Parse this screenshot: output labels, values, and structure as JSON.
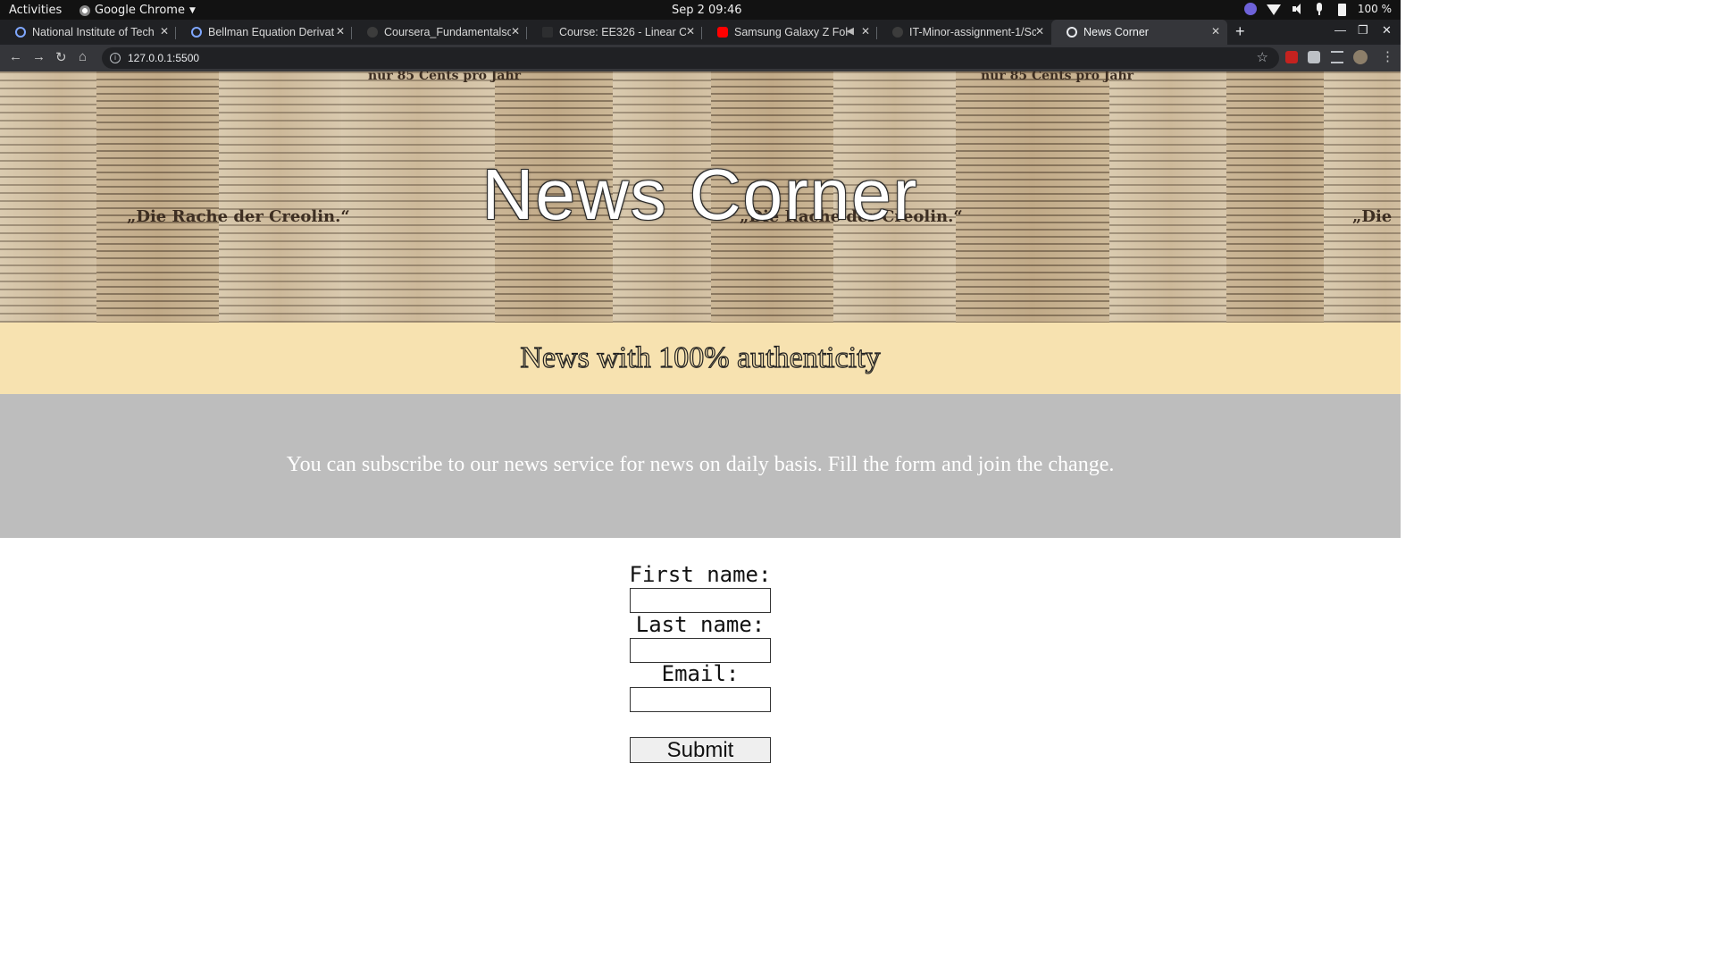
{
  "system_bar": {
    "activities": "Activities",
    "app_name": "Google Chrome",
    "clock": "Sep 2  09:46",
    "battery": "100 %"
  },
  "browser": {
    "tabs": [
      {
        "label": "National Institute of Tech",
        "icon": "link-icon"
      },
      {
        "label": "Bellman Equation Derivat",
        "icon": "link-icon"
      },
      {
        "label": "Coursera_Fundamentalso",
        "icon": "github-icon"
      },
      {
        "label": "Course: EE326 - Linear Co",
        "icon": "course-icon"
      },
      {
        "label": "Samsung Galaxy Z Folc",
        "icon": "youtube-icon"
      },
      {
        "label": "IT-Minor-assignment-1/Sc",
        "icon": "github-icon"
      },
      {
        "label": "News Corner",
        "icon": "globe-icon",
        "active": true
      }
    ],
    "url": "127.0.0.1:5500"
  },
  "page": {
    "title": "News Corner",
    "tagline": "News with 100% authenticity",
    "subscribe_text": "You can subscribe to our news service for news on daily basis. Fill the form and join the change.",
    "hero_fragments": {
      "fraktur_left": "„Die Rache der Creolin.“",
      "fraktur_right": "„Die",
      "masthead": "nur 85 Cents pro Jahr"
    },
    "form": {
      "first_name_label": "First name:",
      "first_name_value": "",
      "last_name_label": "Last name:",
      "last_name_value": "",
      "email_label": "Email:",
      "email_value": "",
      "submit_label": "Submit"
    },
    "colors": {
      "tagline_band": "#f7e2b0",
      "subscribe_band": "#bdbdbd"
    }
  }
}
